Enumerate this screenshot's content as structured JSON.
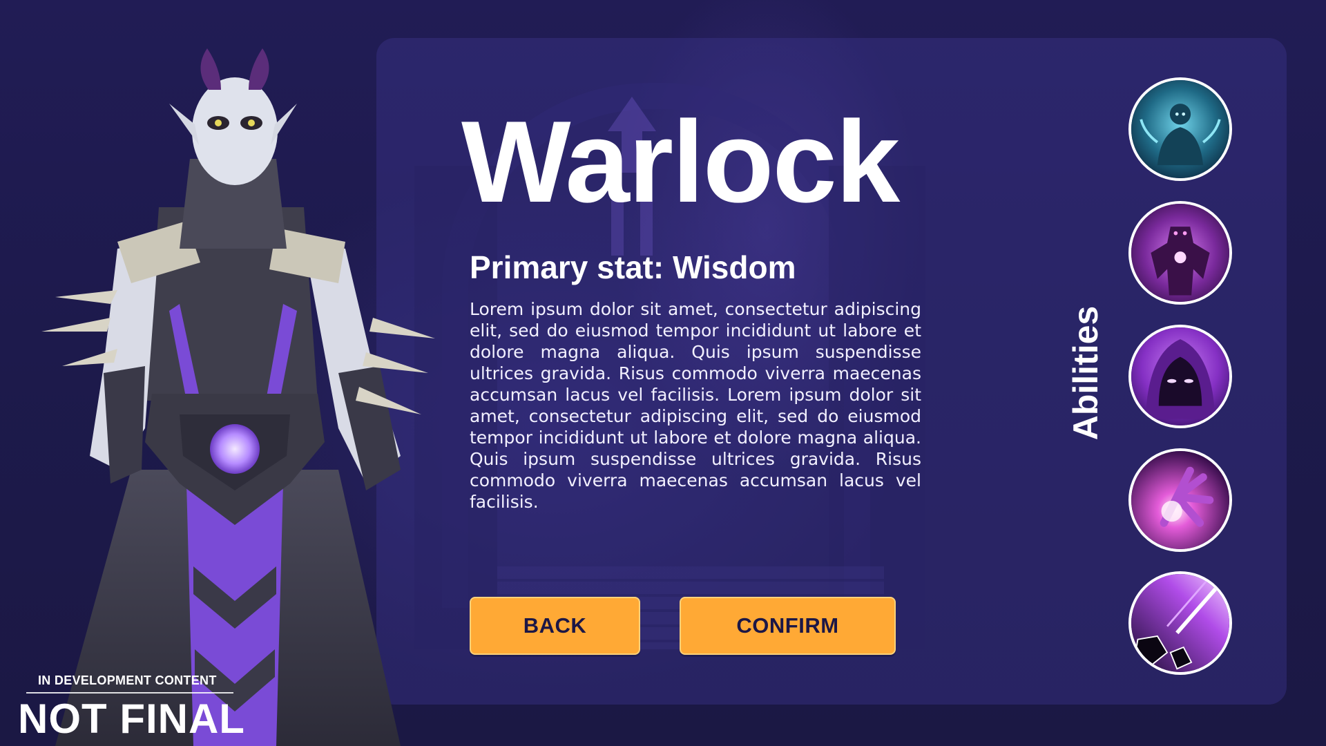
{
  "character": {
    "class_name": "Warlock",
    "primary_stat": "Primary stat: Wisdom",
    "description": "Lorem ipsum dolor sit amet, consectetur adipiscing elit, sed do eiusmod tempor incididunt ut labore et dolore magna aliqua. Quis ipsum suspendisse ultrices gravida. Risus commodo viverra maecenas accumsan lacus vel facilisis. Lorem ipsum dolor sit amet, consectetur adipiscing elit, sed do eiusmod tempor incididunt ut labore et dolore magna aliqua. Quis ipsum suspendisse ultrices gravida. Risus commodo viverra maecenas accumsan lacus vel facilisis."
  },
  "buttons": {
    "back_label": "BACK",
    "confirm_label": "CONFIRM"
  },
  "abilities": {
    "label": "Abilities",
    "items": [
      {
        "icon": "ghost-form-icon"
      },
      {
        "icon": "shadow-demon-icon"
      },
      {
        "icon": "hooded-figure-icon"
      },
      {
        "icon": "arcane-blast-icon"
      },
      {
        "icon": "meteor-strike-icon"
      }
    ]
  },
  "watermark": {
    "small_text": "IN DEVELOPMENT CONTENT",
    "big_text": "NOT FINAL"
  },
  "colors": {
    "background": "#1d1a4c",
    "panel": "#3c348c",
    "button": "#ffa935",
    "button_text": "#1c1746",
    "accent_purple": "#8a4fe0"
  }
}
